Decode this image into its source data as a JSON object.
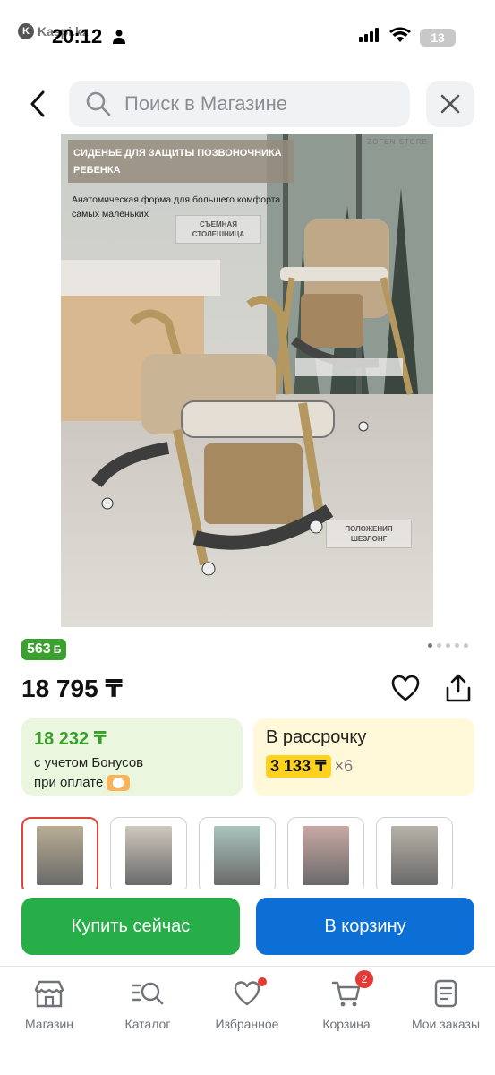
{
  "status_bar": {
    "app_label": "Kaspi.kz",
    "time": "20:12",
    "battery": "13"
  },
  "header": {
    "search_placeholder": "Поиск в Магазине"
  },
  "product_image": {
    "banner_title": "СИДЕНЬЕ ДЛЯ ЗАЩИТЫ ПОЗВОНОЧНИКА РЕБЕНКА",
    "brand": "ZOFEN STORE",
    "description": "Анатомическая форма для большего комфорта самых маленьких",
    "callout_table": "СЪЕМНАЯ СТОЛЕШНИЦА",
    "callout_recline": "ПОЛОЖЕНИЯ ШЕЗЛОНГ",
    "page_count": 5,
    "active_page": 1
  },
  "bonus_badge": "563",
  "price": "18 795 ₸",
  "bonus_card": {
    "price": "18 232 ₸",
    "text_line1": "с учетом Бонусов",
    "text_line2": "при оплате"
  },
  "credit_card": {
    "title": "В рассрочку",
    "monthly": "3 133 ₸",
    "multiplier": "×6"
  },
  "thumbnails": [
    {
      "active": true,
      "color": "#b9ad94"
    },
    {
      "active": false,
      "color": "#cfc8bd"
    },
    {
      "active": false,
      "color": "#a9c4bd"
    },
    {
      "active": false,
      "color": "#c9a8a3"
    },
    {
      "active": false,
      "color": "#b7b2a8"
    }
  ],
  "buttons": {
    "buy": "Купить сейчас",
    "cart": "В корзину"
  },
  "nav": {
    "shop": "Магазин",
    "catalog": "Каталог",
    "favorites": "Избранное",
    "cart": "Корзина",
    "cart_count": "2",
    "orders": "Мои заказы"
  },
  "colors": {
    "green": "#27ae48",
    "blue": "#0c6fd6",
    "bonus_green": "#3aa02e",
    "badge_red": "#e53935"
  }
}
